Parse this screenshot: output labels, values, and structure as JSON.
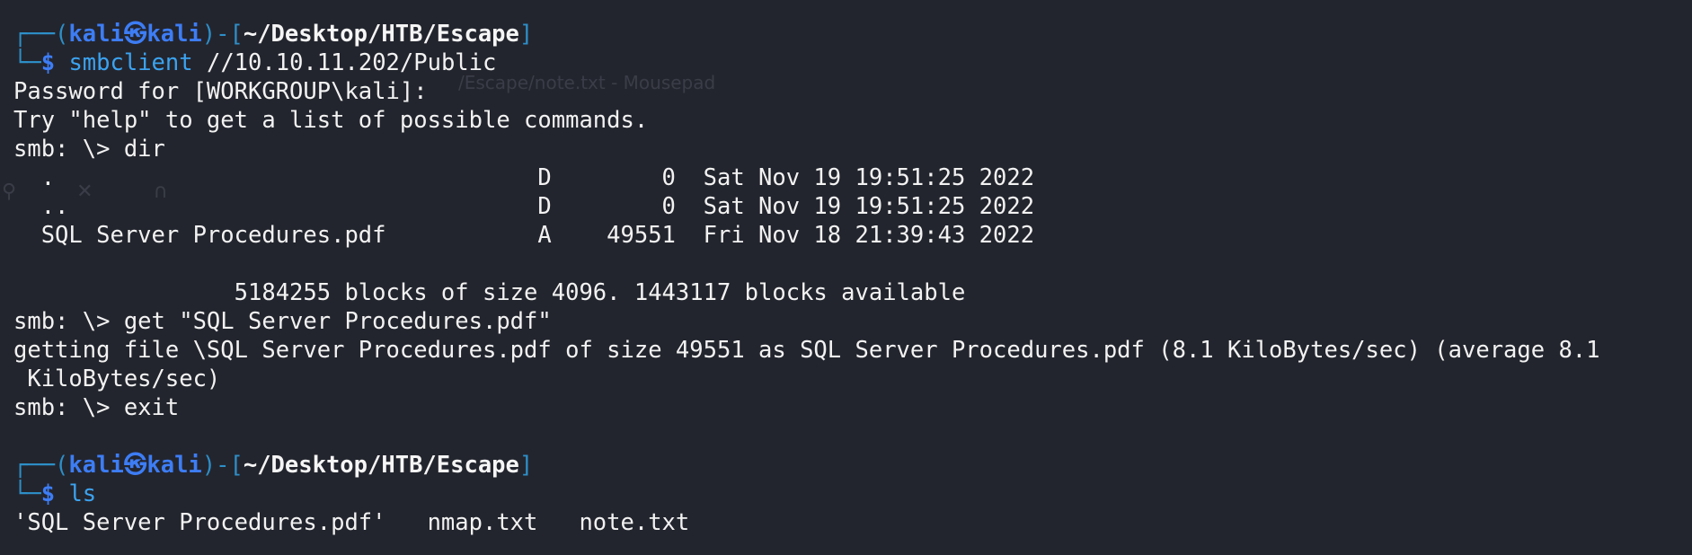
{
  "background_color": "#23252e",
  "accent_colors": {
    "frame": "#2d8fc8",
    "user": "#3d7df5",
    "command": "#3ba3f0",
    "text": "#f2f2f2"
  },
  "ghost_window_title": "/Escape/note.txt - Mousepad",
  "ghost_icons": "⚲ ✕ ∩",
  "prompt1": {
    "corner_top": "┌──(",
    "user": "kali",
    "skull": "㉿",
    "host": "kali",
    "mid": ")-[",
    "path": "~/Desktop/HTB/Escape",
    "close": "]",
    "corner_bottom": "└─",
    "symbol": "$",
    "command": "smbclient",
    "args": " //10.10.11.202/Public"
  },
  "output1": [
    "Password for [WORKGROUP\\kali]:",
    "Try \"help\" to get a list of possible commands.",
    "smb: \\> dir",
    "  .                                   D        0  Sat Nov 19 19:51:25 2022",
    "  ..                                  D        0  Sat Nov 19 19:51:25 2022",
    "  SQL Server Procedures.pdf           A    49551  Fri Nov 18 21:39:43 2022",
    "",
    "                5184255 blocks of size 4096. 1443117 blocks available",
    "smb: \\> get \"SQL Server Procedures.pdf\"",
    "getting file \\SQL Server Procedures.pdf of size 49551 as SQL Server Procedures.pdf (8.1 KiloBytes/sec) (average 8.1",
    " KiloBytes/sec)",
    "smb: \\> exit",
    ""
  ],
  "prompt2": {
    "corner_top": "┌──(",
    "user": "kali",
    "skull": "㉿",
    "host": "kali",
    "mid": ")-[",
    "path": "~/Desktop/HTB/Escape",
    "close": "]",
    "corner_bottom": "└─",
    "symbol": "$",
    "command": "ls",
    "args": ""
  },
  "output2": [
    "'SQL Server Procedures.pdf'   nmap.txt   note.txt"
  ]
}
